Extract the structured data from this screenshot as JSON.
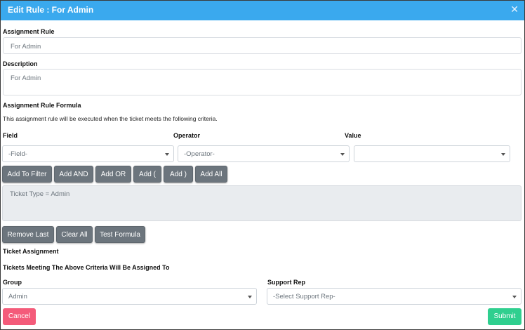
{
  "header": {
    "title": "Edit Rule :  For Admin",
    "close_glyph": "✕"
  },
  "assignment_rule": {
    "label": "Assignment Rule",
    "value": "For Admin"
  },
  "description": {
    "label": "Description",
    "value": "For Admin"
  },
  "formula_section": {
    "heading": "Assignment Rule Formula",
    "help_text": "This assignment rule will be executed when the ticket meets the following criteria.",
    "field": {
      "label": "Field",
      "selected": "-Field-"
    },
    "operator": {
      "label": "Operator",
      "selected": "-Operator-"
    },
    "value": {
      "label": "Value",
      "selected": ""
    },
    "filter_buttons": [
      "Add To Filter",
      "Add AND",
      "Add OR",
      "Add (",
      "Add )",
      "Add All"
    ],
    "formula_text": "Ticket Type = Admin",
    "action_buttons": [
      "Remove Last",
      "Clear All",
      "Test Formula"
    ]
  },
  "ticket_assignment": {
    "heading": "Ticket Assignment",
    "subheading": "Tickets Meeting The Above Criteria Will Be Assigned To",
    "group": {
      "label": "Group",
      "selected": "Admin"
    },
    "support_rep": {
      "label": "Support Rep",
      "selected": "-Select Support Rep-"
    }
  },
  "footer": {
    "cancel_label": "Cancel",
    "submit_label": "Submit"
  },
  "colors": {
    "header": "#3aa9ee",
    "cancel": "#f45b7a",
    "submit": "#2fcf8f",
    "secondary_button": "#6c757d"
  }
}
